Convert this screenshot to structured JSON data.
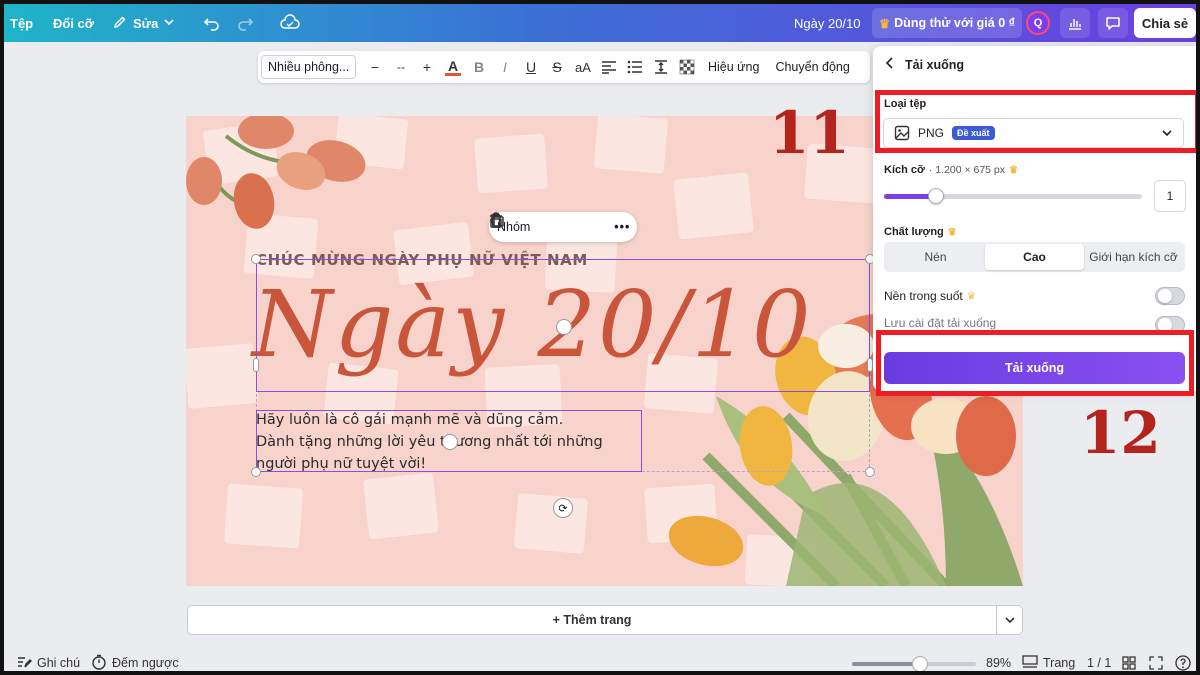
{
  "topbar": {
    "menu_file": "Tệp",
    "menu_resize": "Đổi cỡ",
    "menu_edit": "Sửa",
    "doc_title": "Ngày 20/10",
    "trial_label": "Dùng thử với giá 0 ₫",
    "avatar_letter": "Q",
    "share_label": "Chia sẻ"
  },
  "toolbar": {
    "font_name": "Nhiều phông...",
    "font_size": "--",
    "minus": "−",
    "plus": "+",
    "effects_label": "Hiệu ứng",
    "animate_label": "Chuyển động",
    "text_color": "#e4572e"
  },
  "canvas": {
    "context_menu_label": "Nhóm",
    "heading": "CHÚC MỪNG NGÀY PHỤ NỮ VIỆT NAM",
    "script_title": "Ngày 20/10",
    "body_line1": "Hãy luôn là cô gái mạnh mẽ và dũng cảm.",
    "body_line2": "Dành tặng những lời yêu thương nhất tới những",
    "body_line3": "người phụ nữ tuyệt vời!",
    "background_color": "#f8d3cc",
    "accent_color": "#c9563b"
  },
  "add_page": {
    "label": "+ Thêm trang"
  },
  "bottombar": {
    "notes_label": "Ghi chú",
    "timer_label": "Đếm ngược",
    "zoom_percent": "89%",
    "zoom_value": 0.55,
    "pages_label": "Trang",
    "page_count": "1 / 1"
  },
  "download_panel": {
    "title": "Tải xuống",
    "file_type_label": "Loại tệp",
    "file_type_value": "PNG",
    "file_type_badge": "Đề xuất",
    "size_label": "Kích cỡ",
    "size_dims": "· 1.200 × 675 px",
    "size_value": "1",
    "size_slider_value": 0.2,
    "quality_label": "Chất lượng",
    "quality_options": [
      "Nén",
      "Cao",
      "Giới hạn kích cỡ"
    ],
    "quality_selected": "Cao",
    "transparent_label": "Nền trong suốt",
    "transparent_on": false,
    "save_settings_label": "Lưu cài đặt tải xuống",
    "save_settings_on": false,
    "download_button": "Tải xuống",
    "brand_color": "#7b3fe4"
  },
  "annotations": {
    "step_11": "11",
    "step_12": "12",
    "highlight_color": "#ee1c25"
  }
}
